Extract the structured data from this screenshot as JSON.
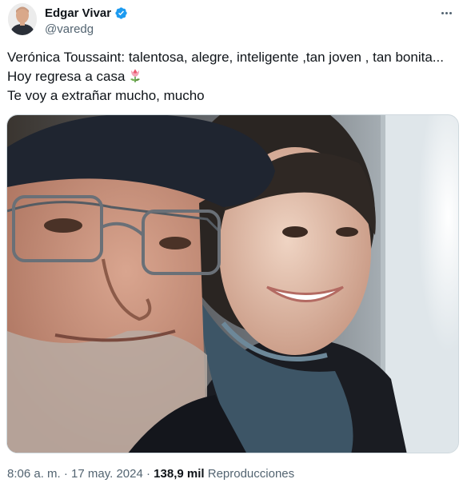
{
  "author": {
    "display_name": "Edgar Vivar",
    "handle": "@varedg",
    "verified": true
  },
  "icons": {
    "verified": "verified-badge-icon",
    "more": "more-options-icon",
    "emoji": "tulip-emoji-icon"
  },
  "tweet": {
    "line1": "Verónica Toussaint: talentosa, alegre, inteligente ,tan joven , tan bonita...",
    "line2": "Hoy regresa a casa",
    "line3": "Te voy a extrañar mucho, mucho"
  },
  "meta": {
    "time": "8:06 a. m.",
    "sep1": " · ",
    "date": "17 may. 2024",
    "sep2": " · ",
    "views": "138,9 mil",
    "views_label": "Reproducciones"
  },
  "colors": {
    "text_primary": "#0f1419",
    "text_secondary": "#536471",
    "verified_blue": "#1d9bf0",
    "border": "#cfd9de"
  }
}
